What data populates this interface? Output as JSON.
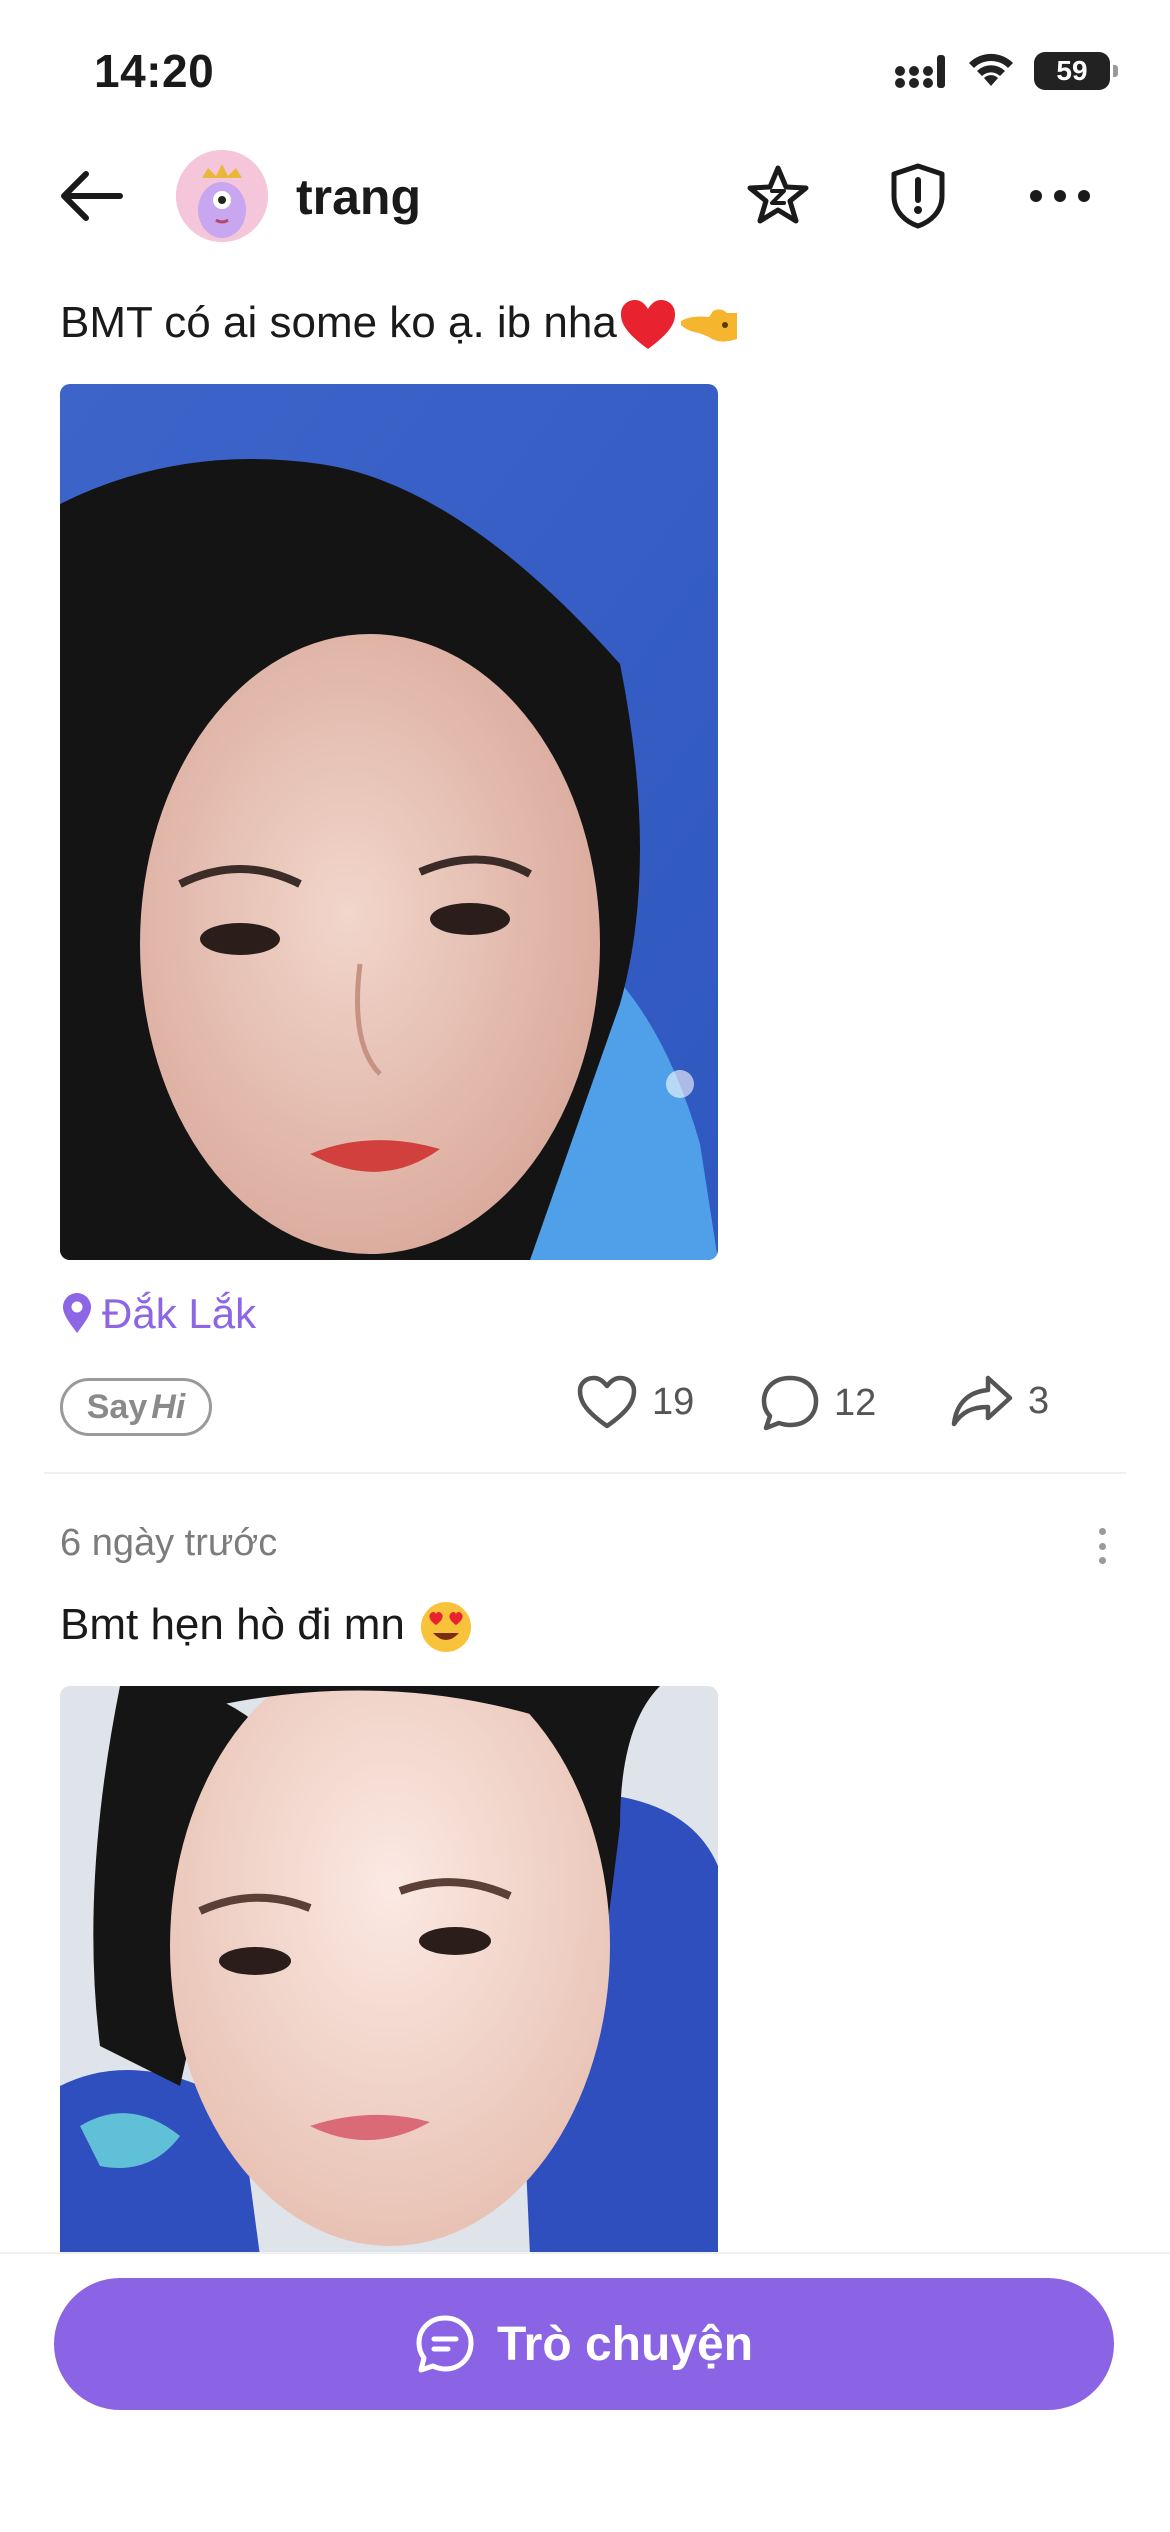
{
  "status_bar": {
    "time": "14:20",
    "battery": "59"
  },
  "header": {
    "username": "trang"
  },
  "posts": [
    {
      "caption": "BMT có ai some ko ạ. ib nha",
      "location": "Đắk Lắk",
      "say_hi": {
        "say": "Say",
        "hi": "Hi"
      },
      "likes": "19",
      "comments": "12",
      "shares": "3"
    },
    {
      "time": "6 ngày trước",
      "caption": "Bmt hẹn hò đi mn"
    }
  ],
  "chat_button": {
    "label": "Trò chuyện"
  },
  "colors": {
    "accent": "#8b64e6",
    "location": "#8d66e6"
  }
}
